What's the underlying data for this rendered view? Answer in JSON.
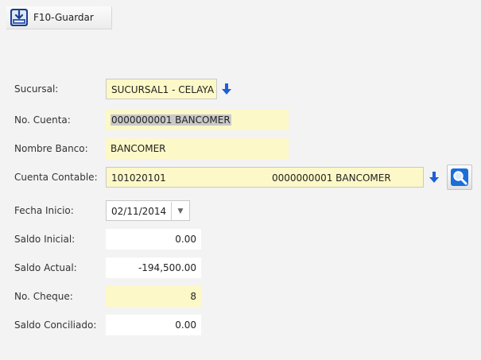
{
  "toolbar": {
    "save_label": "F10-Guardar",
    "save_icon": "save-icon"
  },
  "form": {
    "sucursal": {
      "label": "Sucursal:",
      "value": "SUCURSAL1 - CELAYA"
    },
    "no_cuenta": {
      "label": "No. Cuenta:",
      "value": "0000000001 BANCOMER"
    },
    "nombre_banco": {
      "label": "Nombre Banco:",
      "value": "BANCOMER"
    },
    "cuenta_contable": {
      "label": "Cuenta Contable:",
      "code": "101020101",
      "description": "0000000001 BANCOMER"
    },
    "fecha_inicio": {
      "label": "Fecha Inicio:",
      "value": "02/11/2014"
    },
    "saldo_inicial": {
      "label": "Saldo Inicial:",
      "value": "0.00"
    },
    "saldo_actual": {
      "label": "Saldo Actual:",
      "value": "-194,500.00"
    },
    "no_cheque": {
      "label": "No. Cheque:",
      "value": "8"
    },
    "saldo_conciliado": {
      "label": "Saldo Conciliado:",
      "value": "0.00"
    }
  },
  "colors": {
    "field_yellow": "#fdf8c7",
    "field_white": "#ffffff",
    "arrow_blue": "#1f5fd6",
    "background": "#f3f3f3"
  }
}
